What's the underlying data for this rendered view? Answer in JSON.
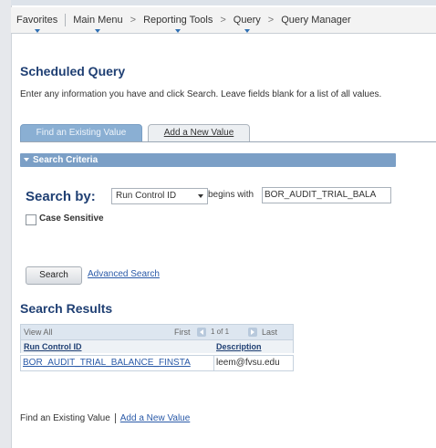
{
  "nav": {
    "items": [
      {
        "label": "Favorites",
        "dropdown": true
      },
      {
        "label": "Main Menu",
        "dropdown": true
      }
    ],
    "breadcrumb": [
      {
        "label": "Reporting Tools",
        "dropdown": true
      },
      {
        "label": "Query",
        "dropdown": true
      },
      {
        "label": "Query Manager",
        "dropdown": false
      }
    ],
    "separator": ">"
  },
  "page": {
    "title": "Scheduled Query",
    "instructions": "Enter any information you have and click Search. Leave fields blank for a list of all values."
  },
  "tabs": [
    {
      "label": "Find an Existing Value",
      "active": true
    },
    {
      "label": "Add a New Value",
      "active": false
    }
  ],
  "criteria": {
    "header": "Search Criteria",
    "search_by_label": "Search by:",
    "field": "Run Control ID",
    "operator": "begins with",
    "value": "BOR_AUDIT_TRIAL_BALA",
    "case_sensitive_label": "Case Sensitive",
    "case_sensitive_checked": false
  },
  "buttons": {
    "search": "Search",
    "advanced_search": "Advanced Search"
  },
  "results": {
    "title": "Search Results",
    "view_all": "View All",
    "first": "First",
    "count": "1 of 1",
    "last": "Last",
    "columns": [
      "Run Control ID",
      "Description"
    ],
    "rows": [
      {
        "run_control_id": "BOR_AUDIT_TRIAL_BALANCE_FINSTA",
        "description": "leem@fvsu.edu"
      }
    ]
  },
  "footer": {
    "find_existing": "Find an Existing Value",
    "add_new": "Add a New Value"
  },
  "colors": {
    "accent": "#1f3f73",
    "link": "#2a5aa8",
    "criteria_header": "#7b9fc6",
    "active_tab": "#8aafd3"
  }
}
